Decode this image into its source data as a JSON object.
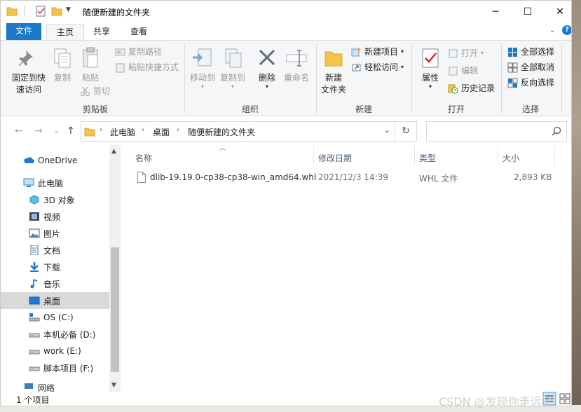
{
  "window": {
    "title": "随便新建的文件夹",
    "minimize": "─",
    "maximize": "☐",
    "close": "✕"
  },
  "tabs": {
    "file": "文件",
    "home": "主页",
    "share": "共享",
    "view": "查看",
    "help": "?"
  },
  "ribbon": {
    "clipboard": {
      "pin": "固定到快\n速访问",
      "pin_l1": "固定到快",
      "pin_l2": "速访问",
      "copy": "复制",
      "paste": "粘贴",
      "copy_path": "复制路径",
      "paste_shortcut": "粘贴快捷方式",
      "cut": "剪切",
      "label": "剪贴板"
    },
    "organize": {
      "move_to": "移动到",
      "copy_to": "复制到",
      "delete": "删除",
      "rename": "重命名",
      "label": "组织"
    },
    "new": {
      "new_folder_l1": "新建",
      "new_folder_l2": "文件夹",
      "new_item": "新建项目",
      "easy_access": "轻松访问",
      "label": "新建"
    },
    "open": {
      "properties": "属性",
      "open": "打开",
      "edit": "编辑",
      "history": "历史记录",
      "label": "打开"
    },
    "select": {
      "select_all": "全部选择",
      "select_none": "全部取消",
      "invert": "反向选择",
      "label": "选择"
    }
  },
  "address": {
    "crumbs": [
      "此电脑",
      "桌面",
      "随便新建的文件夹"
    ]
  },
  "nav": {
    "items": [
      {
        "label": "OneDrive",
        "icon": "cloud-icon"
      },
      {
        "label": "此电脑",
        "icon": "computer-icon"
      },
      {
        "label": "3D 对象",
        "icon": "cube-icon"
      },
      {
        "label": "视频",
        "icon": "video-icon"
      },
      {
        "label": "图片",
        "icon": "picture-icon"
      },
      {
        "label": "文档",
        "icon": "document-icon"
      },
      {
        "label": "下载",
        "icon": "download-icon"
      },
      {
        "label": "音乐",
        "icon": "music-icon"
      },
      {
        "label": "桌面",
        "icon": "desktop-icon"
      },
      {
        "label": "OS (C:)",
        "icon": "os-drive-icon"
      },
      {
        "label": "本机必备 (D:)",
        "icon": "drive-icon"
      },
      {
        "label": "work (E:)",
        "icon": "drive-icon"
      },
      {
        "label": "脚本项目 (F:)",
        "icon": "drive-icon"
      },
      {
        "label": "网络",
        "icon": "network-icon"
      }
    ]
  },
  "list": {
    "headers": [
      "名称",
      "修改日期",
      "类型",
      "大小"
    ],
    "rows": [
      {
        "name": "dlib-19.19.0-cp38-cp38-win_amd64.whl",
        "date": "2021/12/3 14:39",
        "type": "WHL 文件",
        "size": "2,893 KB"
      }
    ]
  },
  "status": {
    "count": "1 个项目"
  },
  "watermark": "CSDN @发现你走远了",
  "colors": {
    "accent": "#1979ca",
    "folder": "#f3c447",
    "selected": "#d9d9d9"
  }
}
